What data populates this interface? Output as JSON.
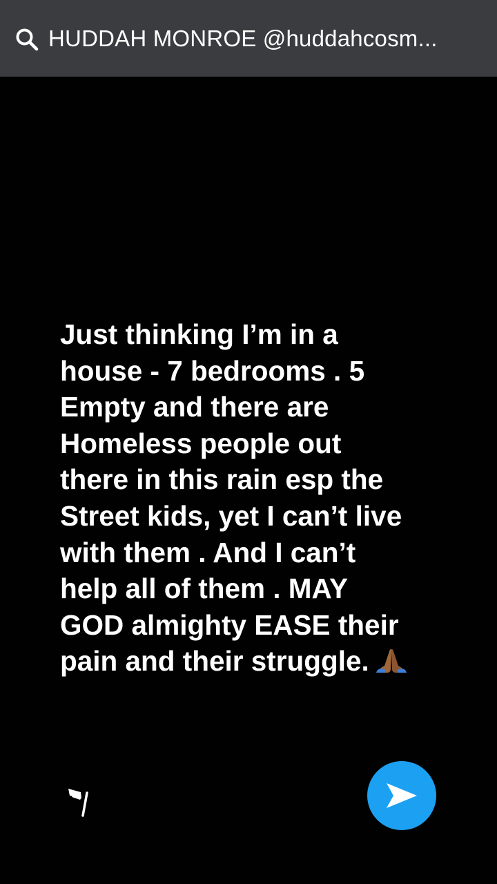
{
  "search": {
    "title": "HUDDAH MONROE @huddahcosm..."
  },
  "story": {
    "lines": [
      "Just thinking I’m in a",
      "house - 7 bedrooms . 5",
      "Empty and there are",
      "Homeless people out",
      "there in this rain esp the",
      "Street kids, yet I can’t live",
      "with them . And I can’t",
      "help all of them . MAY",
      "GOD almighty EASE their",
      "pain and their struggle."
    ],
    "emoji": "folded-hands-emoji"
  },
  "icons": {
    "search": "search-icon",
    "flag": "flag-icon",
    "send": "send-arrow-icon"
  },
  "colors": {
    "search_bar_bg": "#3a3c3f",
    "background": "#010101",
    "send_button": "#1ca0f2",
    "text": "#ffffff"
  }
}
